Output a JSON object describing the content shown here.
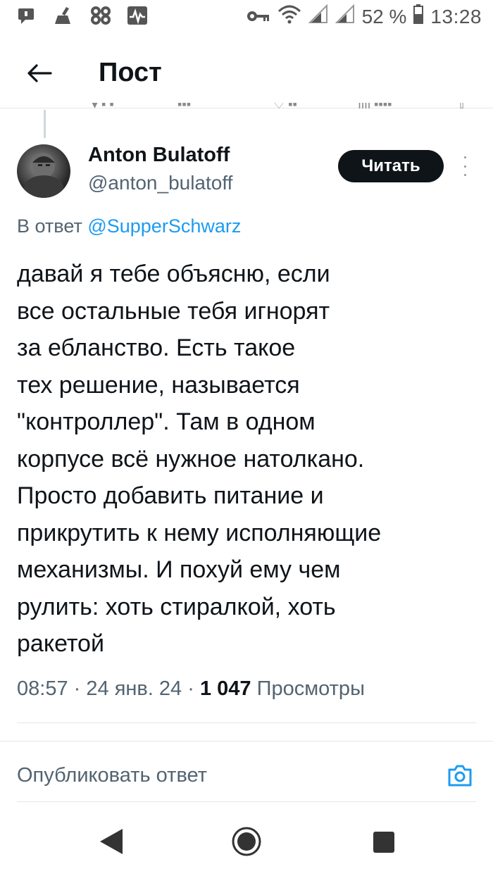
{
  "status_bar": {
    "battery_percent": "52 %",
    "time": "13:28",
    "left_icons": [
      "notification-icon",
      "cleaner-icon",
      "shuffle-icon",
      "activity-icon"
    ],
    "right_icons": [
      "key-icon",
      "wifi-icon",
      "signal-icon",
      "signal-icon",
      "battery-icon"
    ]
  },
  "header": {
    "title": "Пост",
    "back_icon": "arrow-left-icon"
  },
  "tweet": {
    "author": {
      "display_name": "Anton Bulatoff",
      "handle": "@anton_bulatoff"
    },
    "follow_label": "Читать",
    "reply_prefix": "В ответ",
    "reply_mention": "@SupperSchwarz",
    "text_lines": [
      "давай я тебе объясню, если",
      "все остальные тебя игнорят",
      "за ебланство. Есть такое",
      "тех решение, называется",
      "\"контроллер\". Там в одном",
      "корпусе всё нужное натолкано.",
      "Просто добавить питание и",
      "прикрутить к нему исполняющие",
      "механизмы. И похуй ему чем",
      "рулить: хоть стиралкой, хоть",
      "ракетой"
    ],
    "time": "08:57",
    "separator": "·",
    "date": "24 янв. 24",
    "views_count": "1 047",
    "views_label": "Просмотры"
  },
  "reply_box": {
    "placeholder": "Опубликовать ответ",
    "camera_icon": "camera-icon"
  },
  "nav_bar": {
    "icons": [
      "nav-back-icon",
      "nav-home-icon",
      "nav-recents-icon"
    ]
  },
  "colors": {
    "accent": "#1d9bf0",
    "text_primary": "#0f1419",
    "text_secondary": "#536471",
    "follow_button_bg": "#0f1419"
  }
}
